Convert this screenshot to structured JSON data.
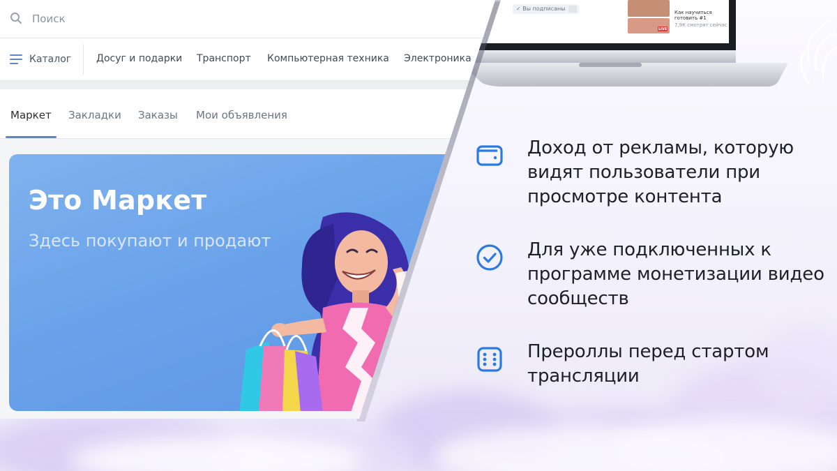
{
  "search": {
    "placeholder": "Поиск"
  },
  "catalog": {
    "button_label": "Каталог",
    "items": [
      "Досуг и подарки",
      "Транспорт",
      "Компьютерная техника",
      "Электроника"
    ]
  },
  "tabs": [
    {
      "label": "Маркет",
      "active": true
    },
    {
      "label": "Закладки",
      "active": false
    },
    {
      "label": "Заказы",
      "active": false
    },
    {
      "label": "Мои объявления",
      "active": false
    }
  ],
  "banner": {
    "title": "Это Маркет",
    "subtitle": "Здесь покупают и продают"
  },
  "laptop_screen": {
    "subscribed_label": "Вы подписаны",
    "video_title": "Как научиться готовить #1 Кулинарные курсы...",
    "video_views": "7,9К смотрят сейчас",
    "live_badge": "LIVE"
  },
  "features": [
    {
      "icon": "wallet-icon",
      "text": "Доход от рекламы, которую видят пользователи при просмотре контента"
    },
    {
      "icon": "check-circle-icon",
      "text": "Для уже подключенных к программе монетизации видео сообществ"
    },
    {
      "icon": "dice-icon",
      "text": "Прероллы перед стартом трансляции"
    }
  ],
  "colors": {
    "accent": "#2a7ae2",
    "banner": "#6aa2ea",
    "text": "#1e2024"
  }
}
